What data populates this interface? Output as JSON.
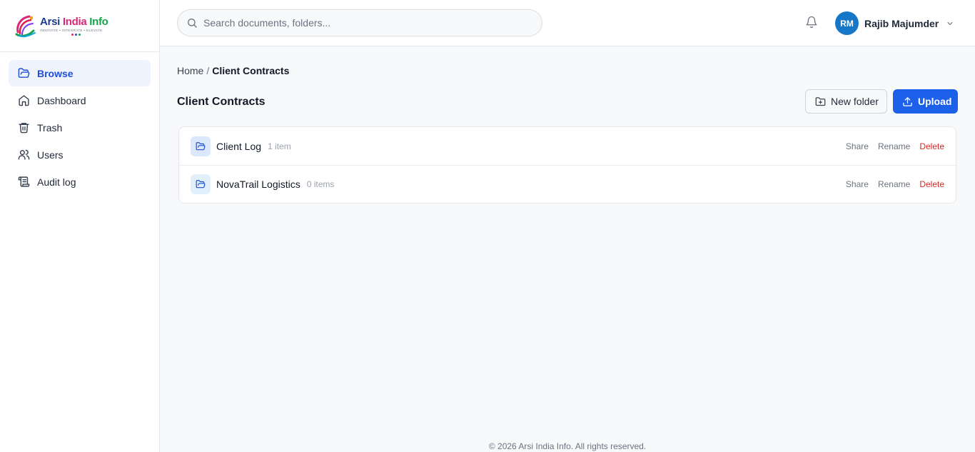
{
  "brand": {
    "name_part1": "Arsi",
    "name_part2": "India",
    "name_part3": "Info",
    "tagline": "INNOVATE • INTEGRATE • ELEVATE"
  },
  "sidebar": {
    "items": [
      {
        "label": "Browse",
        "icon": "folder-open-icon",
        "active": true
      },
      {
        "label": "Dashboard",
        "icon": "home-icon",
        "active": false
      },
      {
        "label": "Trash",
        "icon": "trash-icon",
        "active": false
      },
      {
        "label": "Users",
        "icon": "users-icon",
        "active": false
      },
      {
        "label": "Audit log",
        "icon": "scroll-icon",
        "active": false
      }
    ]
  },
  "header": {
    "search_placeholder": "Search documents, folders...",
    "user_initials": "RM",
    "user_name": "Rajib Majumder"
  },
  "breadcrumb": {
    "home": "Home",
    "separator": "/",
    "current": "Client Contracts"
  },
  "page": {
    "title": "Client Contracts",
    "new_folder_label": "New folder",
    "upload_label": "Upload"
  },
  "folders": [
    {
      "name": "Client Log",
      "meta": "1 item",
      "share": "Share",
      "rename": "Rename",
      "delete": "Delete"
    },
    {
      "name": "NovaTrail Logistics",
      "meta": "0 items",
      "share": "Share",
      "rename": "Rename",
      "delete": "Delete"
    }
  ],
  "footer": {
    "text": "© 2026 Arsi India Info. All rights reserved."
  },
  "colors": {
    "accent": "#1d61ea",
    "active_nav_bg": "#eef3fd",
    "danger": "#dc2626",
    "avatar": "#1677c8"
  }
}
